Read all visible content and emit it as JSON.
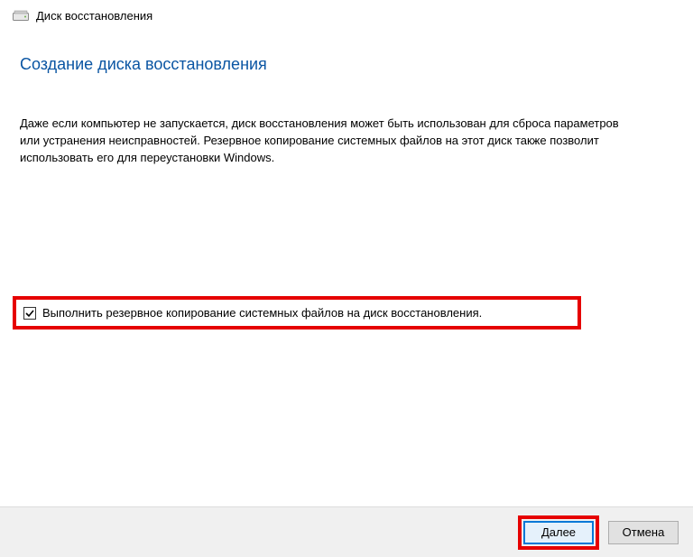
{
  "titlebar": {
    "title": "Диск восстановления"
  },
  "content": {
    "heading": "Создание диска восстановления",
    "description": "Даже если компьютер не запускается, диск восстановления может быть использован для сброса параметров или устранения неисправностей. Резервное копирование системных файлов на этот диск также позволит использовать его для переустановки Windows."
  },
  "checkbox": {
    "checked": true,
    "label": "Выполнить резервное копирование системных файлов на диск восстановления."
  },
  "buttons": {
    "next": "Далее",
    "cancel": "Отмена"
  }
}
